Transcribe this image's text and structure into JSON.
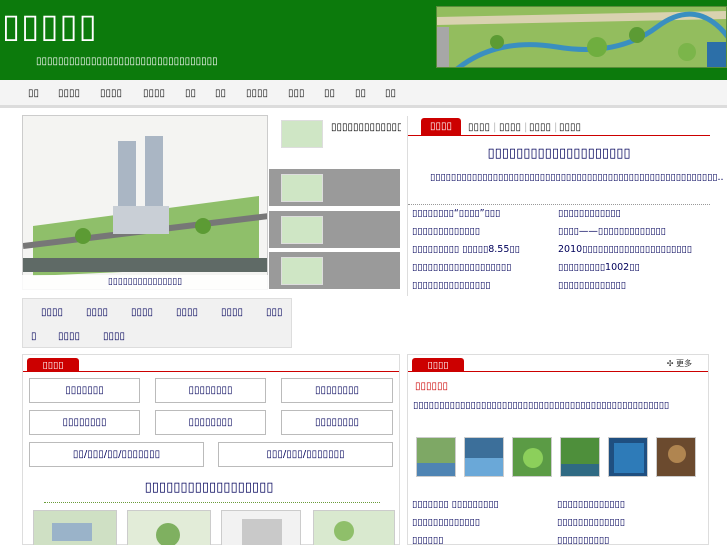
{
  "header": {
    "title": "▯▯▯▯▯",
    "slogan": "▯▯▯▯▯▯▯▯▯▯▯▯▯▯▯▯▯▯▯▯▯▯▯▯▯▯▯▯▯▯▯▯▯",
    "brand_color": "#0c7a0c"
  },
  "nav": {
    "items": [
      "▯▯",
      "▯▯▯▯",
      "▯▯▯▯",
      "▯▯▯▯",
      "▯▯",
      "▯▯",
      "▯▯▯▯",
      "▯▯▯",
      "▯▯",
      "▯▯",
      "▯▯"
    ]
  },
  "slider": {
    "caption": "▯▯▯▯▯▯▯▯▯▯▯▯▯▯▯",
    "thumb_active_text": "▯▯▯▯▯▯▯▯▯▯▯▯▯▯▯▯"
  },
  "categories": [
    "▯▯▯▯",
    "▯▯▯▯",
    "▯▯▯▯",
    "▯▯▯▯",
    "▯▯▯▯",
    "▯▯▯",
    "▯",
    "▯▯▯▯",
    "▯▯▯▯"
  ],
  "news": {
    "tabs": [
      "▯▯▯▯",
      "▯▯▯▯",
      "▯▯▯▯",
      "▯▯▯▯",
      "▯▯▯▯"
    ],
    "headline": "▯▯▯▯▯▯▯▯▯▯▯▯▯▯▯▯▯▯▯▯",
    "summary": "▯▯▯▯▯▯▯▯▯▯▯▯▯▯▯▯▯▯▯▯▯▯▯▯▯▯▯▯▯▯▯▯▯▯▯▯▯▯▯▯▯▯▯▯▯▯▯▯▯▯▯▯▯▯▯..",
    "links_left": [
      "▯▯▯▯▯▯▯▯“▯▯▯▯”▯▯▯",
      "▯▯▯▯▯▯▯▯▯▯▯▯▯",
      "▯▯▯▯▯▯▯▯▯ ▯▯▯▯▯8.55▯▯",
      "▯▯▯▯▯▯▯▯▯▯▯▯▯▯▯▯▯▯▯",
      "▯▯▯▯▯▯▯▯▯▯▯▯▯▯▯"
    ],
    "links_right": [
      "▯▯▯▯▯▯▯▯▯▯▯▯",
      "▯▯▯▯——▯▯▯▯▯▯▯▯▯▯▯▯▯",
      "2010▯▯▯▯▯▯▯▯▯▯▯▯▯▯▯▯▯▯▯▯▯",
      "▯▯▯▯▯▯▯▯▯1002▯▯",
      "▯▯▯▯▯▯▯▯▯▯▯▯▯"
    ]
  },
  "services": {
    "tab": "▯▯▯▯",
    "buttons": [
      "▯▯▯▯▯▯▯",
      "▯▯▯▯▯▯▯▯",
      "▯▯▯▯▯▯▯▯",
      "▯▯▯▯▯▯▯▯",
      "▯▯▯▯▯▯▯▯",
      "▯▯▯▯▯▯▯▯"
    ],
    "wide_buttons": [
      "▯▯/▯▯▯/▯▯/▯▯▯▯▯▯▯",
      "▯▯▯/▯▯▯/▯▯▯▯▯▯▯"
    ],
    "subtitle": "▯▯▯▯▯▯▯▯▯▯▯▯▯▯▯▯▯▯"
  },
  "about": {
    "tab": "▯▯▯▯",
    "more": "更多",
    "title": "▯▯▯▯▯▯",
    "intro": "▯▯▯▯▯▯▯▯▯▯▯▯▯▯▯▯▯▯▯▯▯▯▯▯▯▯▯▯▯▯▯▯▯▯▯▯▯▯▯▯▯▯▯▯▯▯▯▯▯",
    "links_left": [
      "▯▯▯▯▯▯▯ ▯▯▯▯▯▯▯▯▯",
      "▯▯▯▯▯▯▯▯▯▯▯▯▯",
      "▯▯▯▯▯▯"
    ],
    "links_right": [
      "▯▯▯▯▯▯▯▯▯▯▯▯▯",
      "▯▯▯▯▯▯▯▯▯▯▯▯▯",
      "▯▯▯▯▯▯▯▯▯▯"
    ]
  }
}
